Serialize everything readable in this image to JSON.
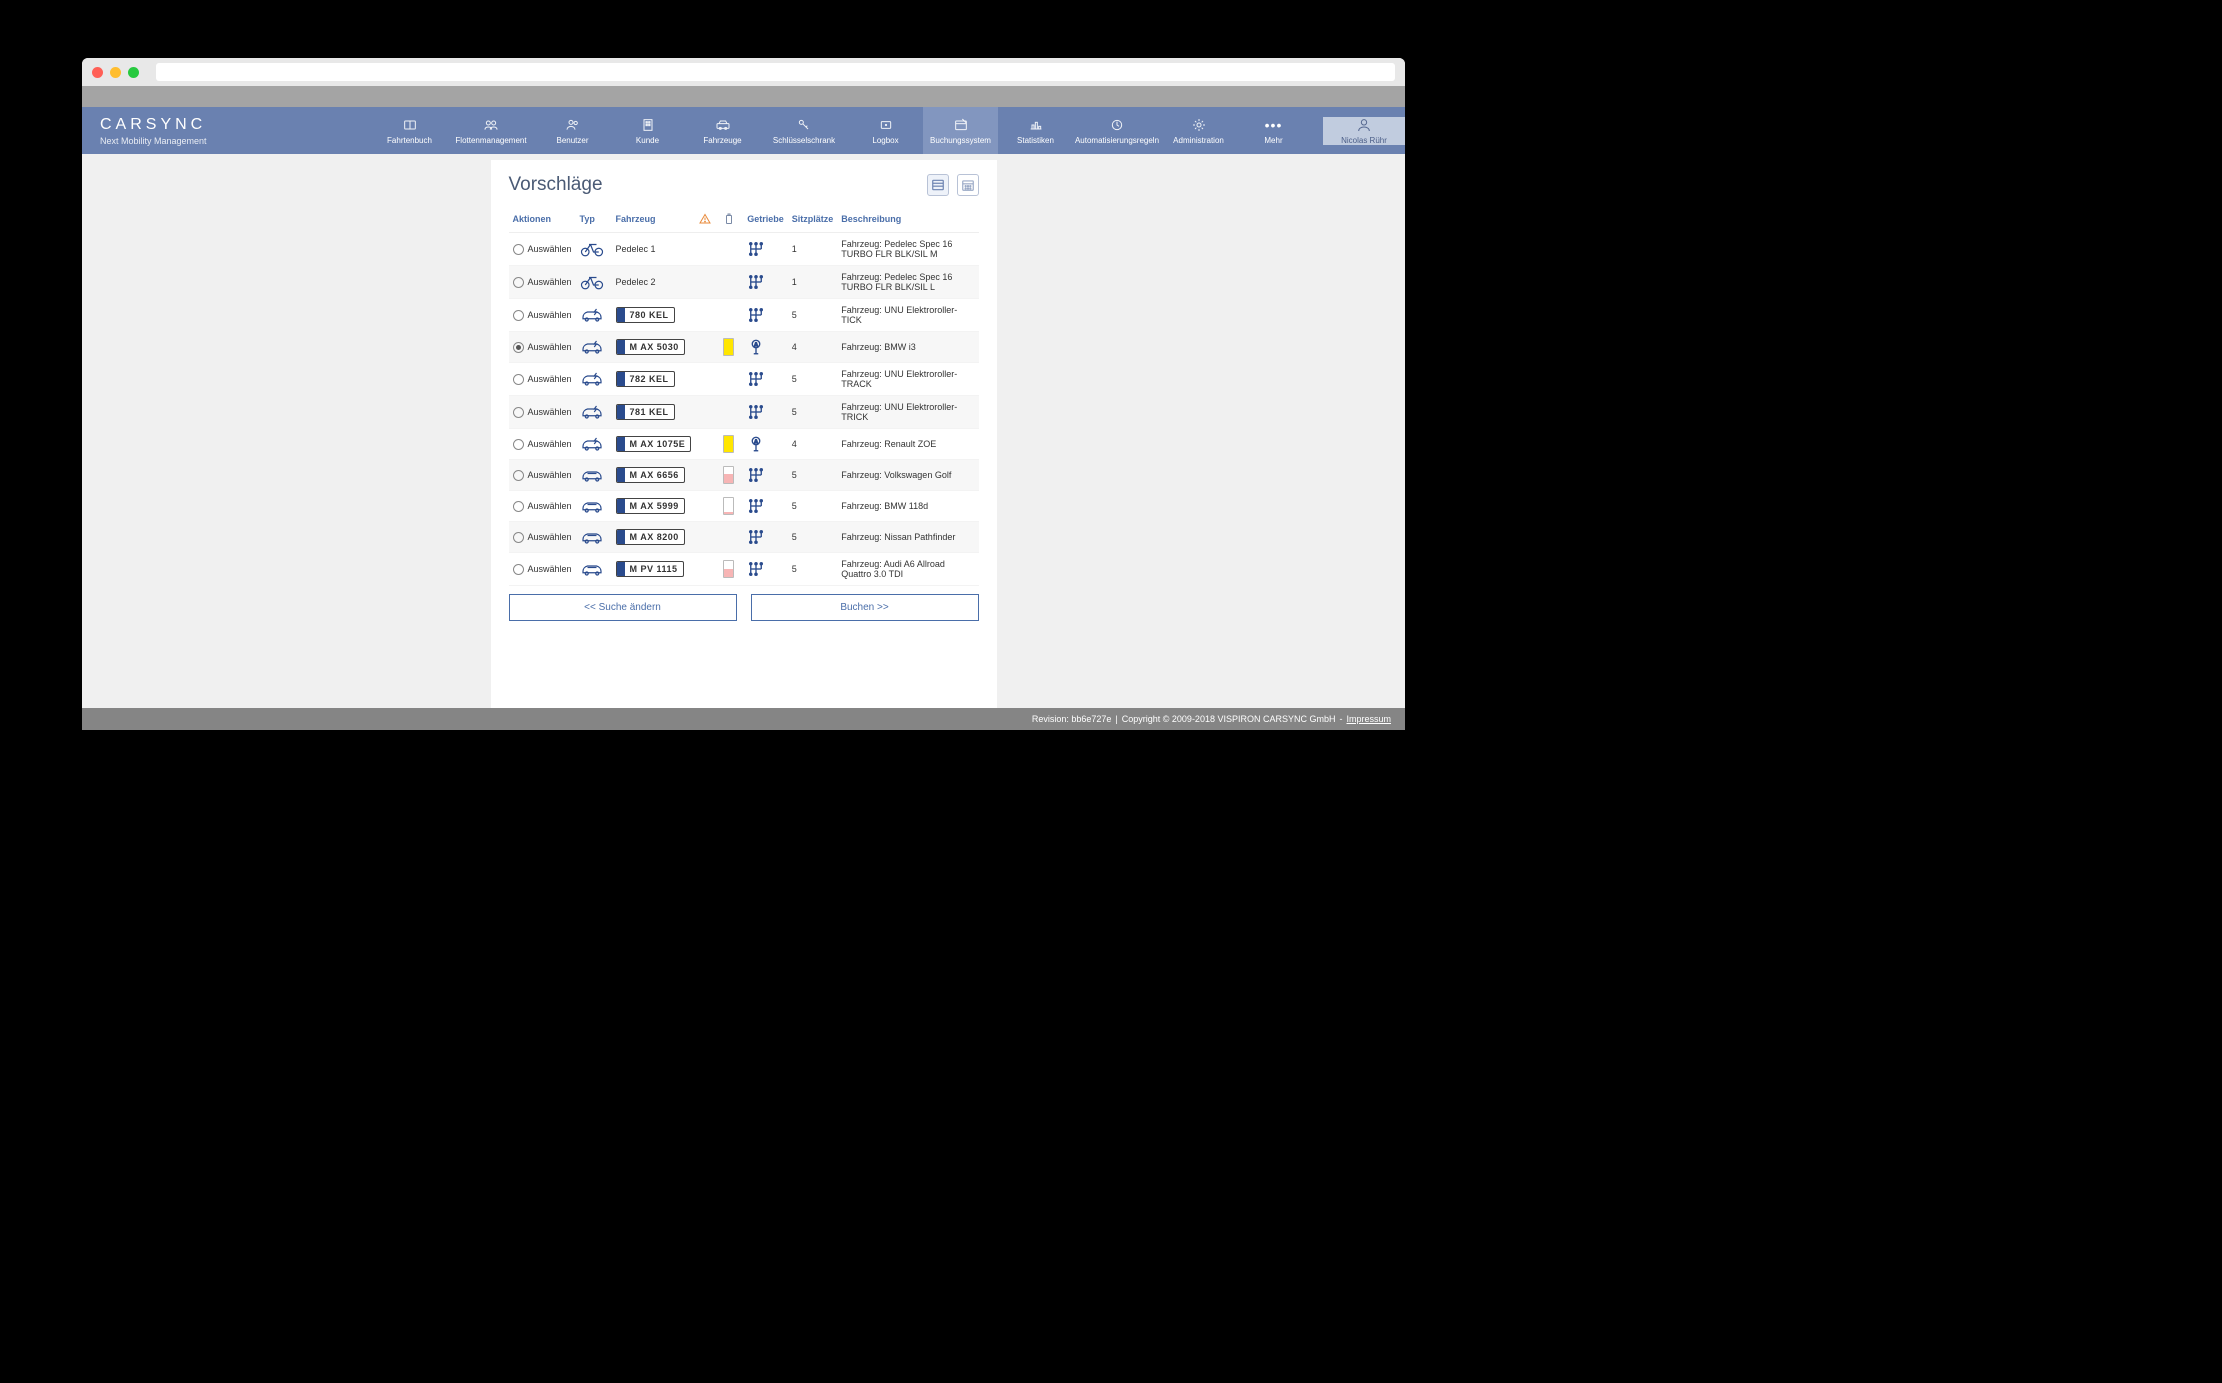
{
  "brand": {
    "name": "CARSYNC",
    "sub": "Next Mobility Management"
  },
  "nav": [
    {
      "label": "Fahrtenbuch"
    },
    {
      "label": "Flottenmanagement"
    },
    {
      "label": "Benutzer"
    },
    {
      "label": "Kunde"
    },
    {
      "label": "Fahrzeuge"
    },
    {
      "label": "Schlüsselschrank"
    },
    {
      "label": "Logbox"
    },
    {
      "label": "Buchungssystem",
      "active": true
    },
    {
      "label": "Statistiken"
    },
    {
      "label": "Automatisierungsregeln"
    },
    {
      "label": "Administration"
    },
    {
      "label": "Mehr"
    }
  ],
  "user": {
    "name": "Nicolas Rühr"
  },
  "panel": {
    "title": "Vorschläge",
    "columns": {
      "aktionen": "Aktionen",
      "typ": "Typ",
      "fahrzeug": "Fahrzeug",
      "warn": "",
      "fuel": "",
      "getriebe": "Getriebe",
      "sitz": "Sitzplätze",
      "beschreibung": "Beschreibung"
    },
    "select_label": "Auswählen",
    "rows": [
      {
        "selected": false,
        "type": "bike",
        "vehicle_text": "Pedelec 1",
        "plate": null,
        "fuel": null,
        "gear": "manual",
        "seats": "1",
        "desc": "Fahrzeug: Pedelec Spec 16 TURBO FLR BLK/SIL M"
      },
      {
        "selected": false,
        "type": "bike",
        "vehicle_text": "Pedelec 2",
        "plate": null,
        "fuel": null,
        "gear": "manual",
        "seats": "1",
        "desc": "Fahrzeug: Pedelec Spec 16 TURBO FLR BLK/SIL L"
      },
      {
        "selected": false,
        "type": "ecar",
        "vehicle_text": null,
        "plate": "780   KEL",
        "fuel": null,
        "gear": "manual",
        "seats": "5",
        "desc": "Fahrzeug: UNU Elektroroller-TICK"
      },
      {
        "selected": true,
        "type": "ecar",
        "vehicle_text": null,
        "plate": "M   AX 5030",
        "fuel": {
          "color": "yellow",
          "pct": 100
        },
        "gear": "auto",
        "seats": "4",
        "desc": "Fahrzeug: BMW i3"
      },
      {
        "selected": false,
        "type": "ecar",
        "vehicle_text": null,
        "plate": "782   KEL",
        "fuel": null,
        "gear": "manual",
        "seats": "5",
        "desc": "Fahrzeug: UNU Elektroroller-TRACK"
      },
      {
        "selected": false,
        "type": "ecar",
        "vehicle_text": null,
        "plate": "781   KEL",
        "fuel": null,
        "gear": "manual",
        "seats": "5",
        "desc": "Fahrzeug: UNU Elektroroller-TRICK"
      },
      {
        "selected": false,
        "type": "ecar",
        "vehicle_text": null,
        "plate": "M   AX 1075E",
        "fuel": {
          "color": "yellow",
          "pct": 100
        },
        "gear": "auto",
        "seats": "4",
        "desc": "Fahrzeug: Renault ZOE"
      },
      {
        "selected": false,
        "type": "car",
        "vehicle_text": null,
        "plate": "M   AX 6656",
        "fuel": {
          "color": "red",
          "pct": 55
        },
        "gear": "manual",
        "seats": "5",
        "desc": "Fahrzeug: Volkswagen Golf"
      },
      {
        "selected": false,
        "type": "car",
        "vehicle_text": null,
        "plate": "M   AX 5999",
        "fuel": {
          "color": "red",
          "pct": 15
        },
        "gear": "manual",
        "seats": "5",
        "desc": "Fahrzeug: BMW 118d"
      },
      {
        "selected": false,
        "type": "car",
        "vehicle_text": null,
        "plate": "M   AX 8200",
        "fuel": null,
        "gear": "manual",
        "seats": "5",
        "desc": "Fahrzeug: Nissan Pathfinder"
      },
      {
        "selected": false,
        "type": "car",
        "vehicle_text": null,
        "plate": "M   PV 1115",
        "fuel": {
          "color": "red",
          "pct": 50
        },
        "gear": "manual",
        "seats": "5",
        "desc": "Fahrzeug: Audi A6 Allroad Quattro 3.0 TDI"
      }
    ],
    "buttons": {
      "back": "<< Suche ändern",
      "book": "Buchen >>"
    }
  },
  "footer": {
    "revision": "Revision: bb6e727e",
    "copyright": "Copyright © 2009-2018 VISPIRON CARSYNC GmbH",
    "impressum": "Impressum"
  }
}
